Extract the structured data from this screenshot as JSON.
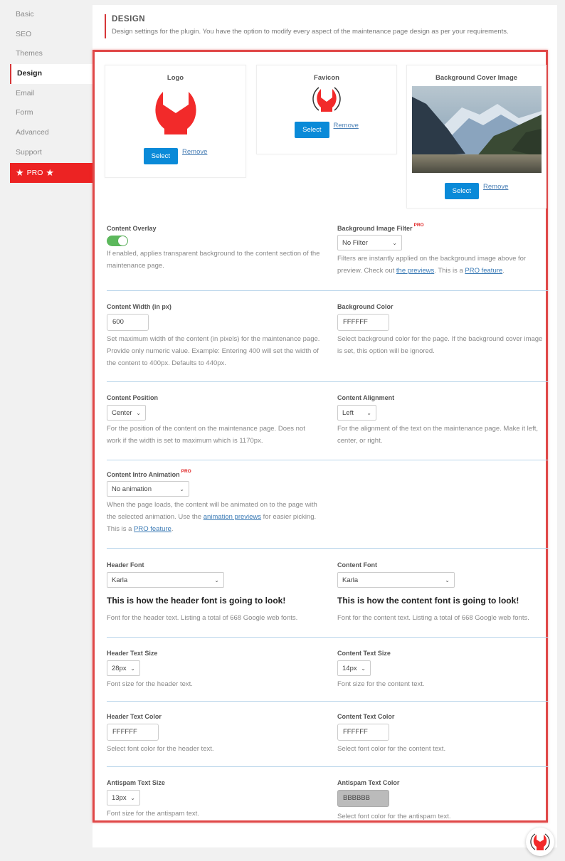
{
  "sidebar": {
    "items": [
      {
        "label": "Basic"
      },
      {
        "label": "SEO"
      },
      {
        "label": "Themes"
      },
      {
        "label": "Design"
      },
      {
        "label": "Email"
      },
      {
        "label": "Form"
      },
      {
        "label": "Advanced"
      },
      {
        "label": "Support"
      }
    ],
    "active": "Design",
    "pro_label": "PRO"
  },
  "header": {
    "title": "DESIGN",
    "description": "Design settings for the plugin. You have the option to modify every aspect of the maintenance page design as per your requirements."
  },
  "images": {
    "logo": {
      "title": "Logo",
      "select": "Select",
      "remove": "Remove"
    },
    "favicon": {
      "title": "Favicon",
      "select": "Select",
      "remove": "Remove"
    },
    "cover": {
      "title": "Background Cover Image",
      "select": "Select",
      "remove": "Remove"
    }
  },
  "pro_badge": "PRO",
  "settings": {
    "content_overlay": {
      "label": "Content Overlay",
      "enabled": true,
      "desc": "If enabled, applies transparent background to the content section of the maintenance page."
    },
    "bg_filter": {
      "label": "Background Image Filter",
      "value": "No Filter",
      "desc_1": "Filters are instantly applied on the background image above for preview. Check out ",
      "link_1": "the previews",
      "desc_2": ". This is a ",
      "link_2": "PRO feature",
      "desc_3": "."
    },
    "content_width": {
      "label": "Content Width (in px)",
      "value": "600",
      "desc": "Set maximum width of the content (in pixels) for the maintenance page. Provide only numeric value. Example: Entering 400 will set the width of the content to 400px. Defaults to 440px."
    },
    "bg_color": {
      "label": "Background Color",
      "value": "FFFFFF",
      "desc": "Select background color for the page. If the background cover image is set, this option will be ignored."
    },
    "content_position": {
      "label": "Content Position",
      "value": "Center",
      "desc": "For the position of the content on the maintenance page. Does not work if the width is set to maximum which is 1170px."
    },
    "content_alignment": {
      "label": "Content Alignment",
      "value": "Left",
      "desc": "For the alignment of the text on the maintenance page. Make it left, center, or right."
    },
    "intro_animation": {
      "label": "Content Intro Animation",
      "value": "No animation",
      "desc_1": "When the page loads, the content will be animated on to the page with the selected animation. Use the ",
      "link_1": "animation previews",
      "desc_2": " for easier picking. This is a ",
      "link_2": "PRO feature",
      "desc_3": "."
    },
    "header_font": {
      "label": "Header Font",
      "value": "Karla",
      "preview": "This is how the header font is going to look!",
      "desc": "Font for the header text. Listing a total of 668 Google web fonts."
    },
    "content_font": {
      "label": "Content Font",
      "value": "Karla",
      "preview": "This is how the content font is going to look!",
      "desc": "Font for the content text. Listing a total of 668 Google web fonts."
    },
    "header_size": {
      "label": "Header Text Size",
      "value": "28px",
      "desc": "Font size for the header text."
    },
    "content_size": {
      "label": "Content Text Size",
      "value": "14px",
      "desc": "Font size for the content text."
    },
    "header_color": {
      "label": "Header Text Color",
      "value": "FFFFFF",
      "desc": "Select font color for the header text."
    },
    "content_color": {
      "label": "Content Text Color",
      "value": "FFFFFF",
      "desc": "Select font color for the content text."
    },
    "antispam_size": {
      "label": "Antispam Text Size",
      "value": "13px",
      "desc": "Font size for the antispam text."
    },
    "antispam_color": {
      "label": "Antispam Text Color",
      "value": "BBBBBB",
      "desc": "Select font color for the antispam text."
    }
  },
  "colors": {
    "accent_red": "#ec2323",
    "button_blue": "#0a8ad8",
    "toggle_green": "#5cb85c",
    "antispam_swatch": "#bbbbbb"
  }
}
